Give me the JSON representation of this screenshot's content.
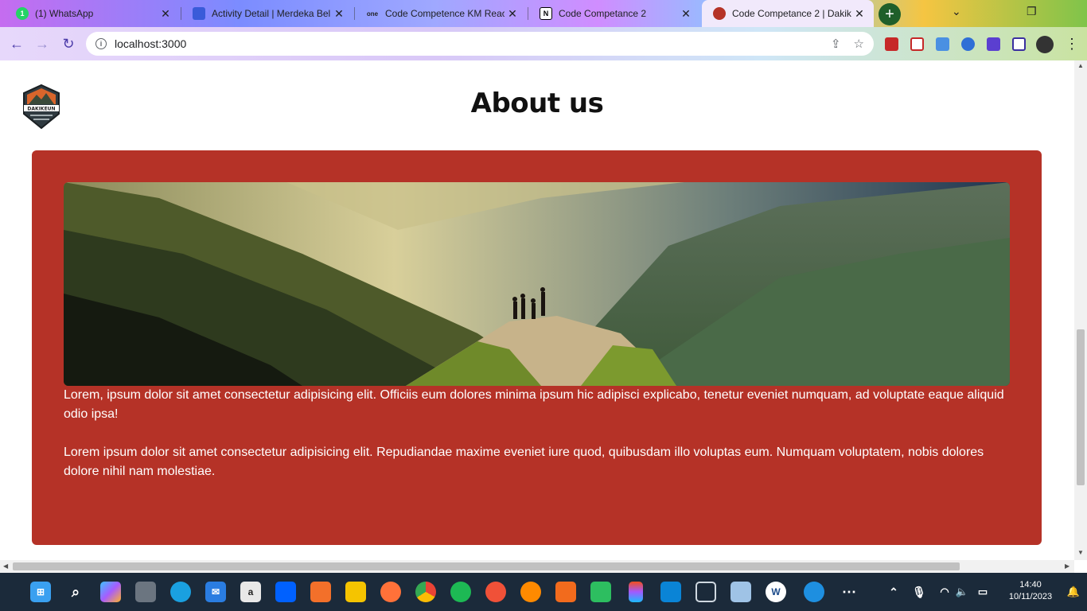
{
  "browser": {
    "tabs": [
      {
        "title": "(1) WhatsApp",
        "favicon": "whatsapp-icon",
        "color": "#25d366"
      },
      {
        "title": "Activity Detail | Merdeka Bel",
        "favicon": "merdeka-icon",
        "color": "#3a5bd9"
      },
      {
        "title": "Code Competence KM Reac",
        "favicon": "onenote-icon",
        "color": "#7719aa"
      },
      {
        "title": "Code Competance 2",
        "favicon": "notion-icon",
        "color": "#000000"
      },
      {
        "title": "Code Competance 2 | Dakik",
        "favicon": "dakikeun-icon",
        "color": "#b53227"
      }
    ],
    "url": "localhost:3000"
  },
  "page": {
    "logo_text": "DAKIKEUN",
    "title": "About us",
    "paragraphs": [
      "Lorem, ipsum dolor sit amet consectetur adipisicing elit. Officiis eum dolores minima ipsum hic adipisci explicabo, tenetur eveniet numquam, ad voluptate eaque aliquid odio ipsa!",
      "Lorem ipsum dolor sit amet consectetur adipisicing elit. Repudiandae maxime eveniet iure quod, quibusdam illo voluptas eum. Numquam voluptatem, nobis dolores dolore nihil nam molestiae."
    ],
    "accent_color": "#b53227"
  },
  "taskbar": {
    "time": "14:40",
    "date": "10/11/2023",
    "apps": [
      "windows-start-icon",
      "search-icon",
      "copilot-icon",
      "task-view-icon",
      "edge-icon",
      "mail-icon",
      "amazon-icon",
      "dropbox-icon",
      "xampp-icon",
      "file-explorer-icon",
      "firefox-icon",
      "chrome-icon",
      "spotify-icon",
      "swift-icon",
      "postman-icon",
      "sourcetree-icon",
      "evernote-icon",
      "figma-icon",
      "vscode-icon",
      "virtualbox-icon",
      "cube-icon",
      "wordpress-icon",
      "edge-dev-icon",
      "more-icon"
    ]
  }
}
